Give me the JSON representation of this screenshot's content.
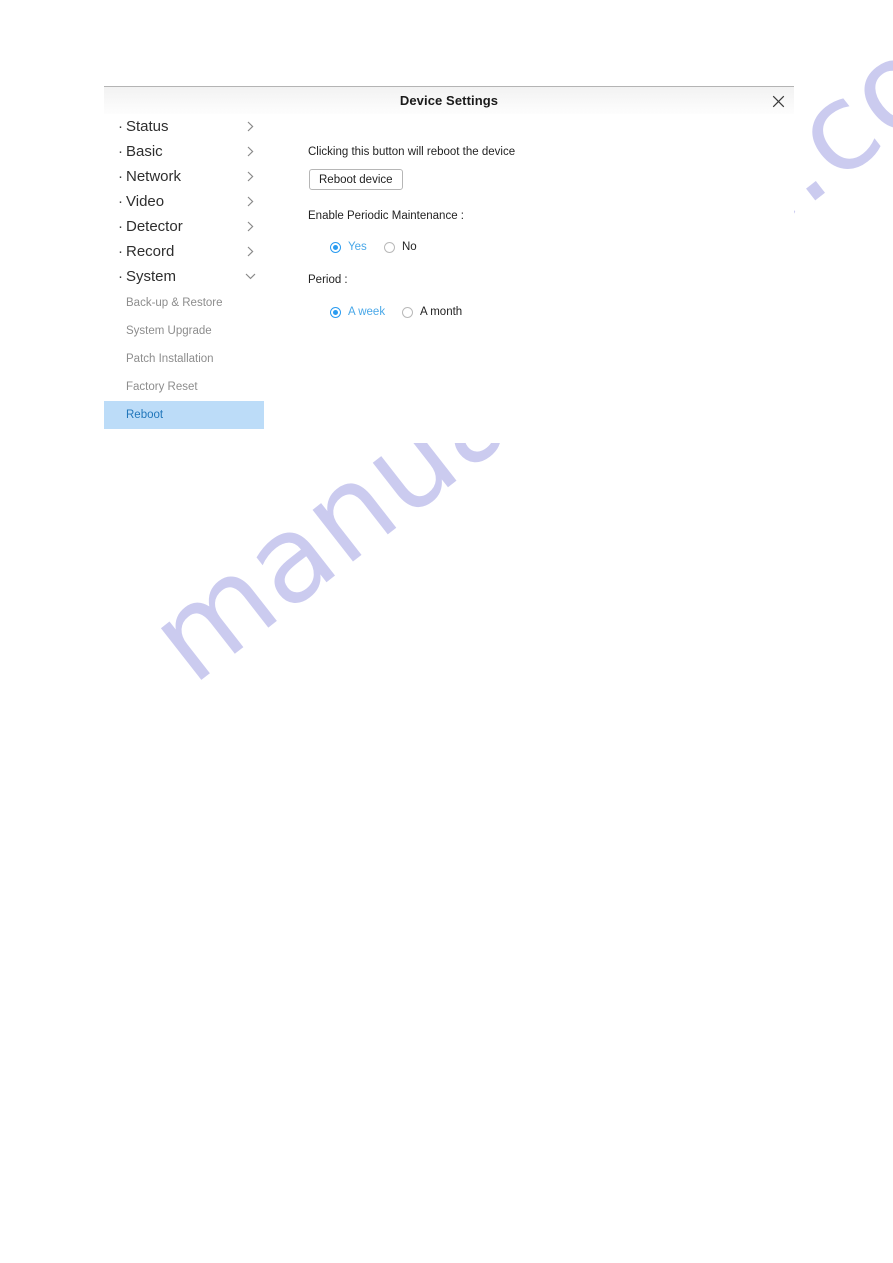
{
  "watermark": {
    "text": "manualshive.com",
    "color": "#c9c9ef"
  },
  "dialog": {
    "title": "Device Settings",
    "close_icon": "close-icon"
  },
  "sidebar": {
    "groups": [
      {
        "bullet": "·",
        "label": "Status",
        "chevron": "chevron-right-icon"
      },
      {
        "bullet": "·",
        "label": "Basic",
        "chevron": "chevron-right-icon"
      },
      {
        "bullet": "·",
        "label": "Network",
        "chevron": "chevron-right-icon"
      },
      {
        "bullet": "·",
        "label": "Video",
        "chevron": "chevron-right-icon"
      },
      {
        "bullet": "·",
        "label": "Detector",
        "chevron": "chevron-right-icon"
      },
      {
        "bullet": "·",
        "label": "Record",
        "chevron": "chevron-right-icon"
      },
      {
        "bullet": "·",
        "label": "System",
        "chevron": "chevron-down-icon"
      }
    ],
    "sub_items": [
      {
        "label": "Back-up & Restore",
        "active": false
      },
      {
        "label": "System Upgrade",
        "active": false
      },
      {
        "label": "Patch Installation",
        "active": false
      },
      {
        "label": "Factory Reset",
        "active": false
      },
      {
        "label": "Reboot",
        "active": true
      }
    ],
    "active_color": "#bcdcf8",
    "active_text_color": "#2277bb"
  },
  "content": {
    "hint": "Clicking this button will reboot the device",
    "reboot_button": "Reboot device",
    "maintenance": {
      "label": "Enable Periodic Maintenance :",
      "options": [
        {
          "label": "Yes",
          "selected": true
        },
        {
          "label": "No",
          "selected": false
        }
      ]
    },
    "period": {
      "label": "Period :",
      "options": [
        {
          "label": "A week",
          "selected": true
        },
        {
          "label": "A month",
          "selected": false
        }
      ]
    },
    "accent_color": "#2a9bf0"
  }
}
